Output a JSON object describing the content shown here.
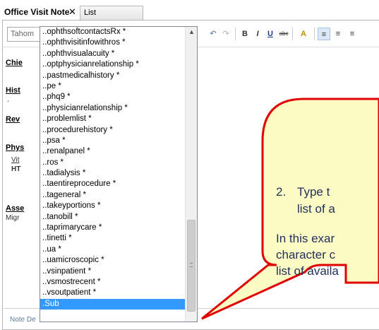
{
  "tabs": {
    "active_label": "Office Visit Note",
    "close_glyph": "✕",
    "second_label": "List"
  },
  "toolbar": {
    "font_value": "Tahom",
    "undo_glyph": "↶",
    "redo_glyph": "↷",
    "bold_label": "B",
    "italic_label": "I",
    "underline_label": "U",
    "strike_label": "abc",
    "font_color_label": "A",
    "align_left_glyph": "≡",
    "align_center_glyph": "≡",
    "align_right_glyph": "≡"
  },
  "document": {
    "chief": "Chie",
    "hist": "Hist",
    "hist_dot": ".",
    "rev": "Rev",
    "phys": "Phys",
    "vit": "Vit",
    "ht": "HT",
    "asse": "Asse",
    "migr": "Migr",
    "note_label": "Note De"
  },
  "dropdown": {
    "items": [
      "..ophthsoftcontactsRx *",
      "..ophthvisitinfowithros *",
      "..ophthvisualacuity *",
      "..optphysicianrelationship *",
      "..pastmedicalhistory *",
      "..pe *",
      "..phq9 *",
      "..physicianrelationship *",
      "..problemlist *",
      "..procedurehistory *",
      "..psa *",
      "..renalpanel *",
      "..ros *",
      "..tadialysis *",
      "..taentireprocedure *",
      "..tageneral *",
      "..takeyportions *",
      "..tanobill *",
      "..taprimarycare *",
      "..tinetti *",
      "..ua *",
      "..uamicroscopic *",
      "..vsinpatient *",
      "..vsmostrecent *",
      "..vsoutpatient *",
      ".Sub"
    ],
    "selected_index": 25,
    "scroll_up_glyph": "▲"
  },
  "callout": {
    "step_number": "2.",
    "line1": "Type t",
    "line2": "list of a",
    "line3": "In this exar",
    "line4": "character c",
    "line5": "list of availa"
  },
  "colors": {
    "callout_fill": "#fdfbc4",
    "callout_border": "#e00000",
    "selection": "#3399ff"
  }
}
